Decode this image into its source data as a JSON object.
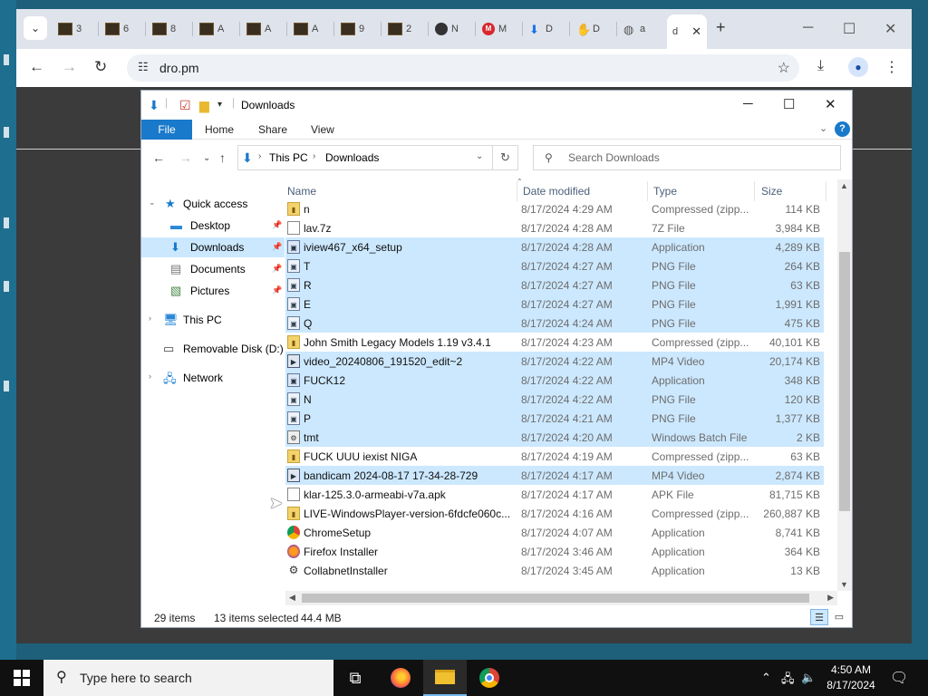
{
  "browser": {
    "tabs": [
      {
        "label": "3",
        "icon": "dark-thumb"
      },
      {
        "label": "6",
        "icon": "dark-thumb"
      },
      {
        "label": "8",
        "icon": "dark-thumb"
      },
      {
        "label": "A",
        "icon": "dark-thumb"
      },
      {
        "label": "A",
        "icon": "dark-thumb"
      },
      {
        "label": "A",
        "icon": "dark-thumb"
      },
      {
        "label": "9",
        "icon": "dark-thumb"
      },
      {
        "label": "2",
        "icon": "dark-thumb"
      },
      {
        "label": "N",
        "icon": "github"
      },
      {
        "label": "M",
        "icon": "mega"
      },
      {
        "label": "D",
        "icon": "download"
      },
      {
        "label": "D",
        "icon": "hand"
      },
      {
        "label": "a",
        "icon": "globe"
      }
    ],
    "active_tab": {
      "label": "d"
    },
    "url": "dro.pm"
  },
  "explorer": {
    "title": "Downloads",
    "ribbon": {
      "file": "File",
      "home": "Home",
      "share": "Share",
      "view": "View"
    },
    "address": {
      "root": "This PC",
      "current": "Downloads"
    },
    "search_placeholder": "Search Downloads",
    "nav": {
      "quick_access": "Quick access",
      "desktop": "Desktop",
      "downloads": "Downloads",
      "documents": "Documents",
      "pictures": "Pictures",
      "this_pc": "This PC",
      "removable": "Removable Disk (D:)",
      "network": "Network"
    },
    "columns": {
      "name": "Name",
      "date": "Date modified",
      "type": "Type",
      "size": "Size"
    },
    "files": [
      {
        "name": "n",
        "date": "8/17/2024 4:29 AM",
        "type": "Compressed (zipp...",
        "size": "114 KB",
        "icon": "zip",
        "selected": false
      },
      {
        "name": "lav.7z",
        "date": "8/17/2024 4:28 AM",
        "type": "7Z File",
        "size": "3,984 KB",
        "icon": "file",
        "selected": false
      },
      {
        "name": "iview467_x64_setup",
        "date": "8/17/2024 4:28 AM",
        "type": "Application",
        "size": "4,289 KB",
        "icon": "app",
        "selected": true
      },
      {
        "name": "T",
        "date": "8/17/2024 4:27 AM",
        "type": "PNG File",
        "size": "264 KB",
        "icon": "png",
        "selected": true
      },
      {
        "name": "R",
        "date": "8/17/2024 4:27 AM",
        "type": "PNG File",
        "size": "63 KB",
        "icon": "png",
        "selected": true
      },
      {
        "name": "E",
        "date": "8/17/2024 4:27 AM",
        "type": "PNG File",
        "size": "1,991 KB",
        "icon": "png",
        "selected": true
      },
      {
        "name": "Q",
        "date": "8/17/2024 4:24 AM",
        "type": "PNG File",
        "size": "475 KB",
        "icon": "png",
        "selected": true
      },
      {
        "name": "John Smith Legacy Models 1.19 v3.4.1",
        "date": "8/17/2024 4:23 AM",
        "type": "Compressed (zipp...",
        "size": "40,101 KB",
        "icon": "zip",
        "selected": false
      },
      {
        "name": "video_20240806_191520_edit~2",
        "date": "8/17/2024 4:22 AM",
        "type": "MP4 Video",
        "size": "20,174 KB",
        "icon": "vid",
        "selected": true
      },
      {
        "name": "FUCK12",
        "date": "8/17/2024 4:22 AM",
        "type": "Application",
        "size": "348 KB",
        "icon": "app",
        "selected": true
      },
      {
        "name": "N",
        "date": "8/17/2024 4:22 AM",
        "type": "PNG File",
        "size": "120 KB",
        "icon": "png",
        "selected": true
      },
      {
        "name": "P",
        "date": "8/17/2024 4:21 AM",
        "type": "PNG File",
        "size": "1,377 KB",
        "icon": "png",
        "selected": true
      },
      {
        "name": "tmt",
        "date": "8/17/2024 4:20 AM",
        "type": "Windows Batch File",
        "size": "2 KB",
        "icon": "bat",
        "selected": true
      },
      {
        "name": "FUCK UUU iexist NIGA",
        "date": "8/17/2024 4:19 AM",
        "type": "Compressed (zipp...",
        "size": "63 KB",
        "icon": "zip",
        "selected": false
      },
      {
        "name": "bandicam 2024-08-17 17-34-28-729",
        "date": "8/17/2024 4:17 AM",
        "type": "MP4 Video",
        "size": "2,874 KB",
        "icon": "vid",
        "selected": true
      },
      {
        "name": "klar-125.3.0-armeabi-v7a.apk",
        "date": "8/17/2024 4:17 AM",
        "type": "APK File",
        "size": "81,715 KB",
        "icon": "file",
        "selected": false
      },
      {
        "name": "LIVE-WindowsPlayer-version-6fdcfe060c...",
        "date": "8/17/2024 4:16 AM",
        "type": "Compressed (zipp...",
        "size": "260,887 KB",
        "icon": "zip",
        "selected": false
      },
      {
        "name": "ChromeSetup",
        "date": "8/17/2024 4:07 AM",
        "type": "Application",
        "size": "8,741 KB",
        "icon": "chrome",
        "selected": false
      },
      {
        "name": "Firefox Installer",
        "date": "8/17/2024 3:46 AM",
        "type": "Application",
        "size": "364 KB",
        "icon": "firefox",
        "selected": false
      },
      {
        "name": "CollabnetInstaller",
        "date": "8/17/2024 3:45 AM",
        "type": "Application",
        "size": "13 KB",
        "icon": "cog",
        "selected": false
      }
    ],
    "status": {
      "items": "29 items",
      "selected": "13 items selected",
      "size": "44.4 MB"
    }
  },
  "taskbar": {
    "search_placeholder": "Type here to search",
    "time": "4:50 AM",
    "date": "8/17/2024"
  },
  "colors": {
    "accent": "#1979ca",
    "selection": "#cce8ff",
    "taskbar": "#101010"
  }
}
